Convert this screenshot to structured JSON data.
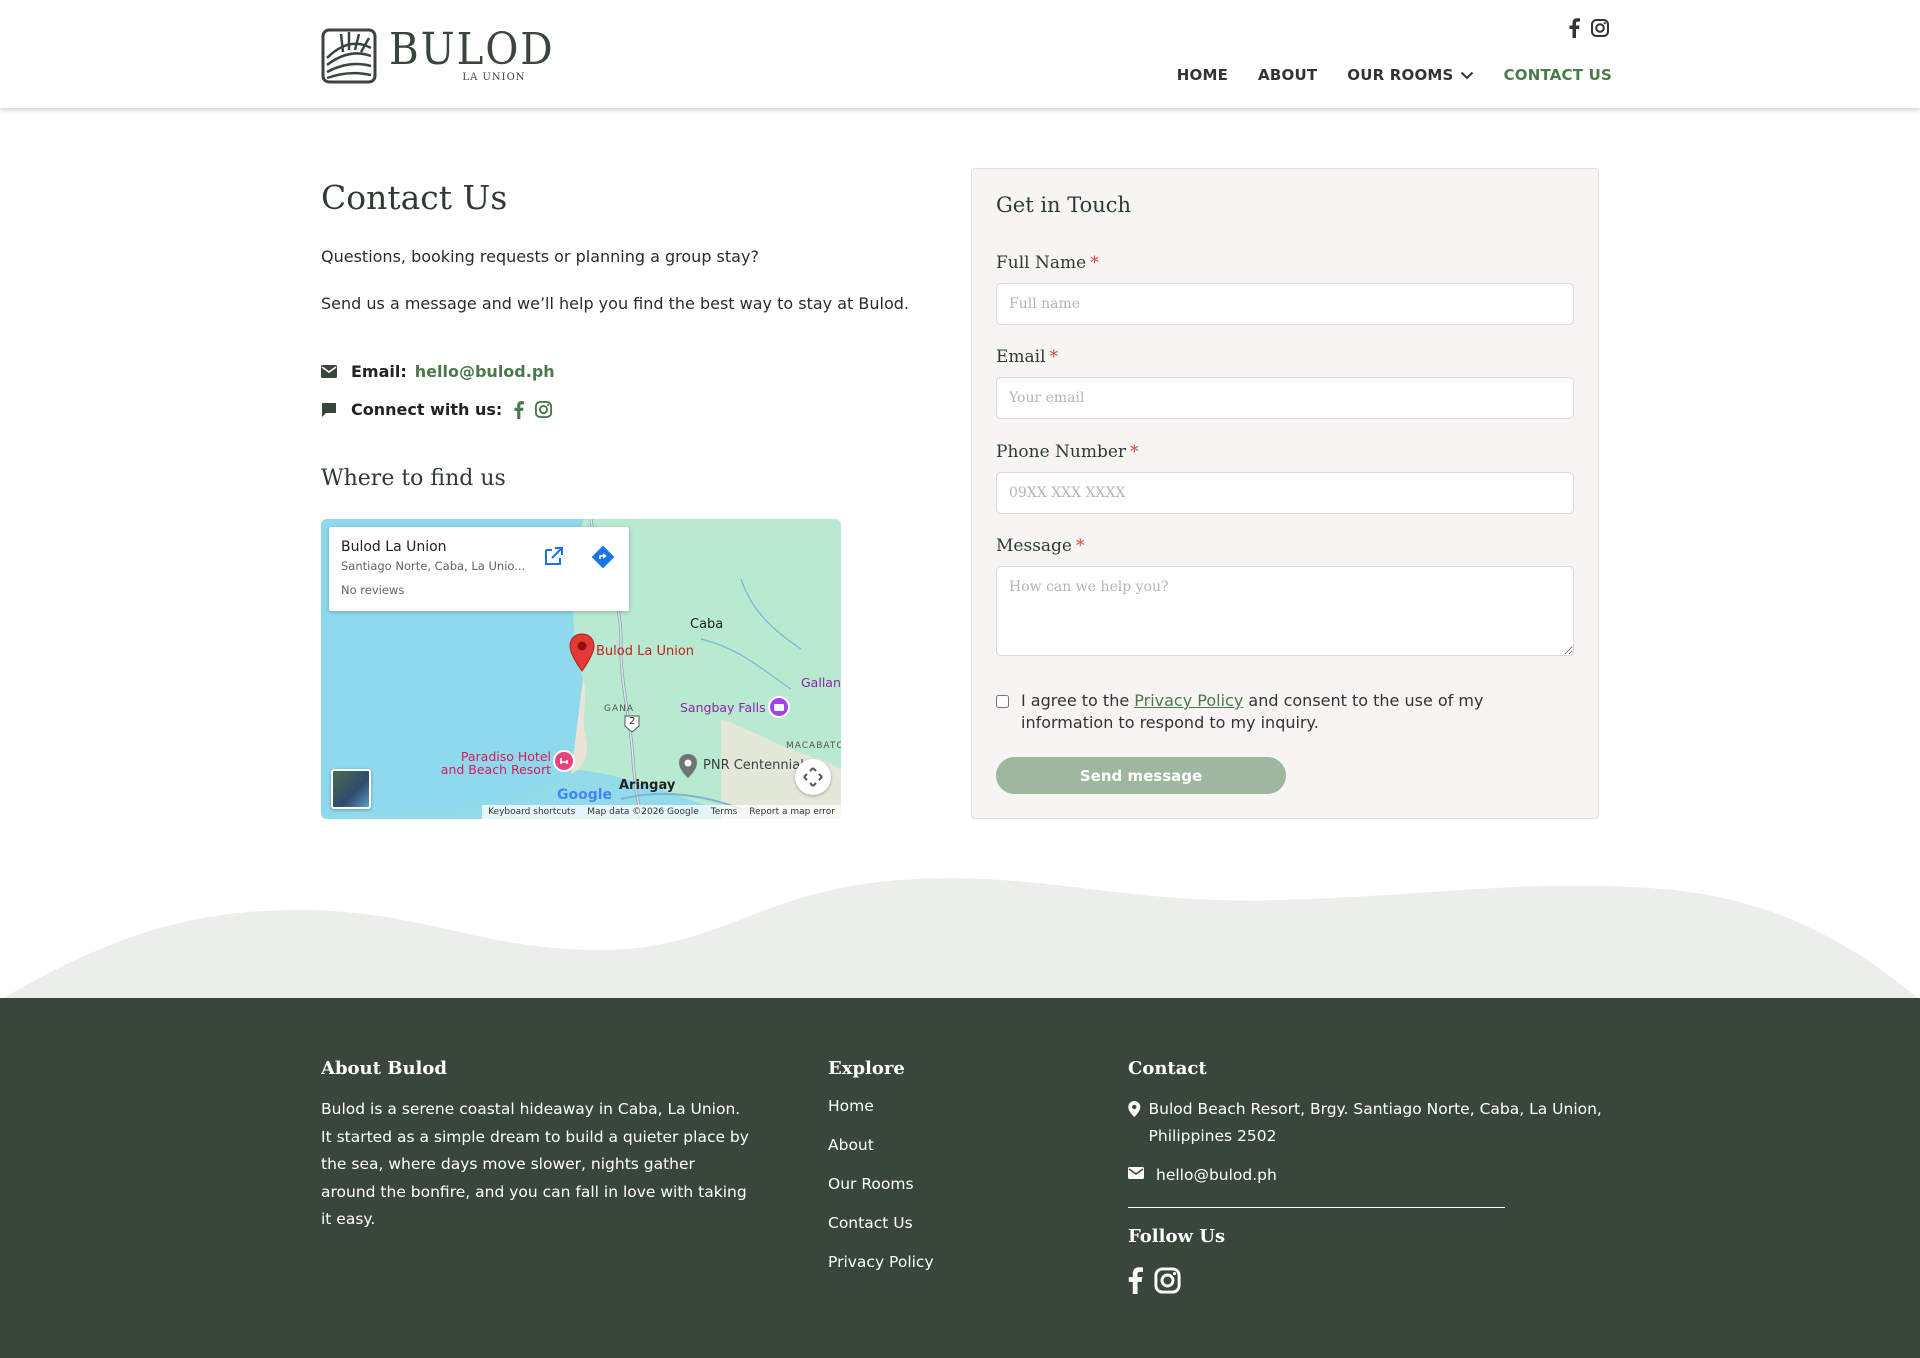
{
  "brand": {
    "name": "BULOD",
    "subtitle": "LA UNION"
  },
  "nav": {
    "items": [
      "HOME",
      "ABOUT",
      "OUR ROOMS",
      "CONTACT US"
    ],
    "active": "CONTACT US"
  },
  "contact": {
    "title": "Contact Us",
    "intro_1": "Questions, booking requests or planning a group stay?",
    "intro_2": "Send us a message and we’ll help you find the best way to stay at Bulod.",
    "email_label": "Email:",
    "email_value": "hello@bulod.ph",
    "connect_label": "Connect with us:",
    "find_title": "Where to find us"
  },
  "map": {
    "place_name": "Bulod La Union",
    "place_address": "Santiago Norte, Caba, La Unio...",
    "reviews": "No reviews",
    "labels": {
      "caba": "Caba",
      "pin": "Bulod La Union",
      "gallan": "Gallan",
      "sangbay": "Sangbay Falls",
      "gana": "GANA",
      "macabato": "MACABATO",
      "paradiso_1": "Paradiso Hotel",
      "paradiso_2": "and Beach Resort",
      "pnr": "PNR Centennial",
      "aringay": "Aringay",
      "route": "2",
      "google": "Google"
    },
    "footer": {
      "keyboard": "Keyboard shortcuts",
      "data": "Map data ©2026 Google",
      "terms": "Terms",
      "report": "Report a map error"
    }
  },
  "form": {
    "title": "Get in Touch",
    "full_name_label": "Full Name",
    "full_name_placeholder": "Full name",
    "email_label": "Email",
    "email_placeholder": "Your email",
    "phone_label": "Phone Number",
    "phone_placeholder": "09XX XXX XXXX",
    "message_label": "Message",
    "message_placeholder": "How can we help you?",
    "required_mark": "*",
    "consent_before": "I agree to the ",
    "consent_link": "Privacy Policy",
    "consent_after": " and consent to the use of my information to respond to my inquiry.",
    "submit_label": "Send message"
  },
  "footer": {
    "about_title": "About Bulod",
    "about_text": "Bulod is a serene coastal hideaway in Caba, La Union. It started as a simple dream to build a quieter place by the sea, where days move slower, nights gather around the bonfire, and you can fall in love with taking it easy.",
    "explore_title": "Explore",
    "explore_links": [
      "Home",
      "About",
      "Our Rooms",
      "Contact Us",
      "Privacy Policy"
    ],
    "contact_title": "Contact",
    "address": "Bulod Beach Resort, Brgy. Santiago Norte, Caba, La Union, Philippines 2502",
    "email": "hello@bulod.ph",
    "follow_title": "Follow Us"
  },
  "colors": {
    "accent_green": "#4a7a4c",
    "footer_bg": "#38463c",
    "button_bg": "#9db89f",
    "required": "#d9453d"
  },
  "icons": [
    "facebook-icon",
    "instagram-icon",
    "envelope-icon",
    "chat-icon",
    "map-pin-icon",
    "chevron-down-icon"
  ]
}
